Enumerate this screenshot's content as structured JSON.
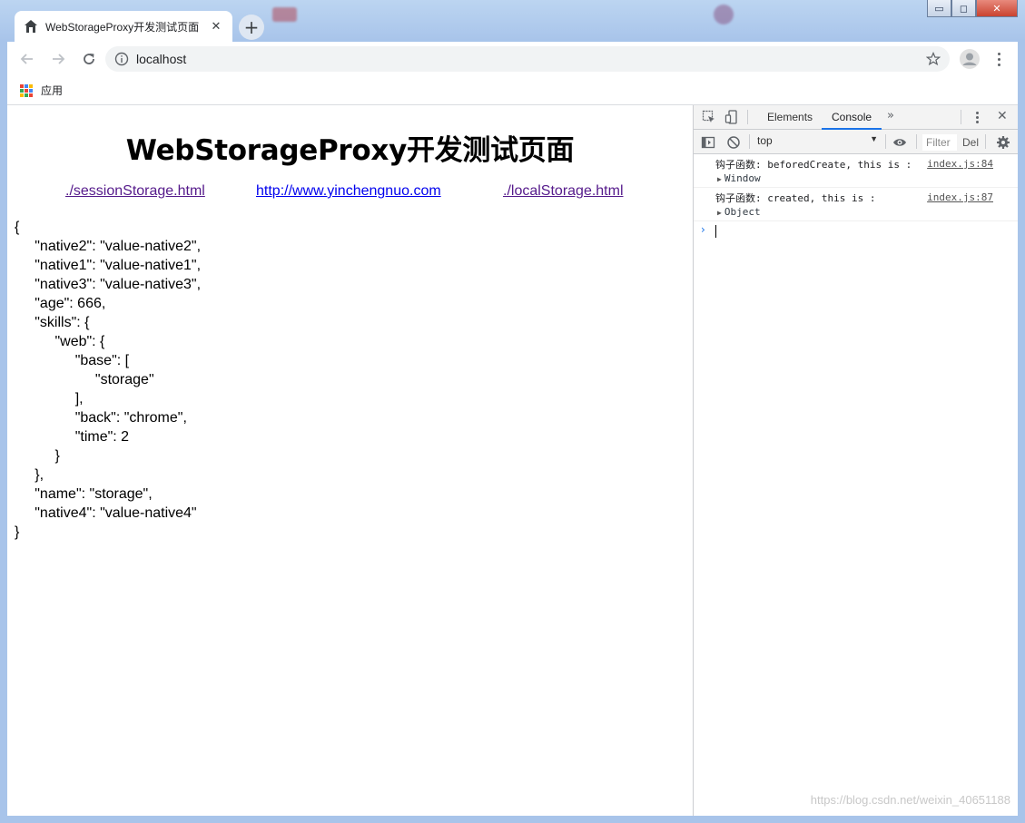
{
  "browser": {
    "tab_title": "WebStorageProxy开发测试页面",
    "tab_close": "✕",
    "new_tab": "+",
    "url": "localhost",
    "bookmarks_apps_label": "应用"
  },
  "window_controls": {
    "minimize": "▭",
    "restore": "◻",
    "close": "✕"
  },
  "page": {
    "heading": "WebStorageProxy开发测试页面",
    "links": [
      {
        "text": "./sessionStorage.html"
      },
      {
        "text": "http://www.yinchengnuo.com"
      },
      {
        "text": "./localStorage.html"
      }
    ],
    "json_text": "{\n\t\"native2\": \"value-native2\",\n\t\"native1\": \"value-native1\",\n\t\"native3\": \"value-native3\",\n\t\"age\": 666,\n\t\"skills\": {\n\t\t\"web\": {\n\t\t\t\"base\": [\n\t\t\t\t\"storage\"\n\t\t\t],\n\t\t\t\"back\": \"chrome\",\n\t\t\t\"time\": 2\n\t\t}\n\t},\n\t\"name\": \"storage\",\n\t\"native4\": \"value-native4\"\n}"
  },
  "devtools": {
    "tabs": [
      "Elements",
      "Console"
    ],
    "active_tab": "Console",
    "more_tabs": "»",
    "close": "✕",
    "context": "top",
    "context_arrow": "▼",
    "filter_placeholder": "Filter",
    "levels": "Del",
    "messages": [
      {
        "text": "钩子函数: beforedCreate, this is :",
        "source": "index.js:84",
        "object": "Window"
      },
      {
        "text": "钩子函数: created, this is :",
        "source": "index.js:87",
        "object": "Object"
      }
    ],
    "prompt": "›"
  },
  "watermark": "https://blog.csdn.net/weixin_40651188",
  "colors": {
    "link_visited": "#551a8b",
    "link_unvisited": "#0000ee",
    "devtools_active": "#1a73e8"
  }
}
